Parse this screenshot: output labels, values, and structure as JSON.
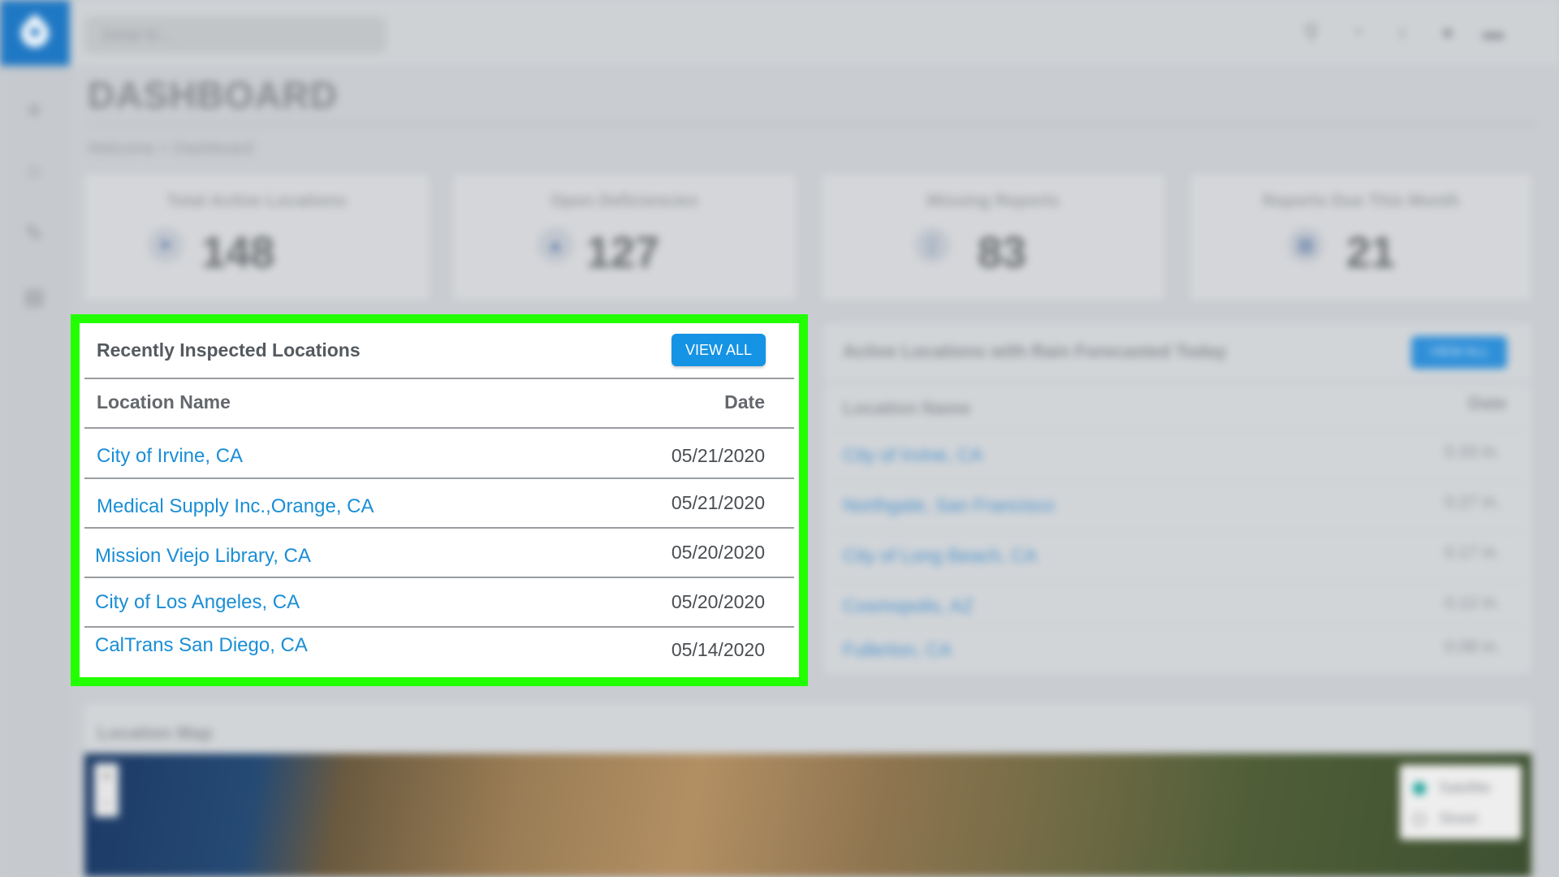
{
  "header": {
    "search_placeholder": "Jump to...",
    "page_title": "DASHBOARD",
    "breadcrumb": [
      "Welcome",
      ">",
      "Dashboard"
    ]
  },
  "stats": [
    {
      "label": "Total Active Locations",
      "value": "148",
      "icon": "navigation-arrow-icon"
    },
    {
      "label": "Open Deficiencies",
      "value": "127",
      "icon": "warning-triangle-icon"
    },
    {
      "label": "Missing Reports",
      "value": "83",
      "icon": "document-icon"
    },
    {
      "label": "Reports Due This Month",
      "value": "21",
      "icon": "calendar-icon"
    }
  ],
  "recent": {
    "title": "Recently Inspected Locations",
    "view_all": "VIEW ALL",
    "col_name": "Location Name",
    "col_date": "Date",
    "rows": [
      {
        "name": "City of Irvine, CA",
        "date": "05/21/2020"
      },
      {
        "name": "Medical Supply Inc.,Orange, CA",
        "date": "05/21/2020"
      },
      {
        "name": "Mission Viejo Library, CA",
        "date": "05/20/2020"
      },
      {
        "name": "City of Los Angeles, CA",
        "date": "05/20/2020"
      },
      {
        "name": "CalTrans San Diego, CA",
        "date": "05/14/2020"
      }
    ]
  },
  "rain": {
    "title": "Active Locations with Rain Forecasted Today",
    "view_all": "VIEW ALL",
    "col_name": "Location Name",
    "col_date": "Date",
    "rows": [
      {
        "name": "City of Irvine, CA",
        "value": "0.33 in."
      },
      {
        "name": "Northgate, San Francisco",
        "value": "0.27 in."
      },
      {
        "name": "City of Long Beach, CA",
        "value": "0.17 in."
      },
      {
        "name": "Cosmopolis, AZ",
        "value": "0.12 in."
      },
      {
        "name": "Fullerton, CA",
        "value": "0.08 in."
      }
    ]
  },
  "map": {
    "title": "Location Map",
    "zoom_in": "+",
    "zoom_out": "-",
    "layers": [
      "Satellite",
      "Street"
    ],
    "selected_layer": "Satellite"
  },
  "colors": {
    "accent": "#1593e4",
    "highlight": "#22ff00",
    "link": "#1a8ed6",
    "brand": "#1f78c4"
  }
}
